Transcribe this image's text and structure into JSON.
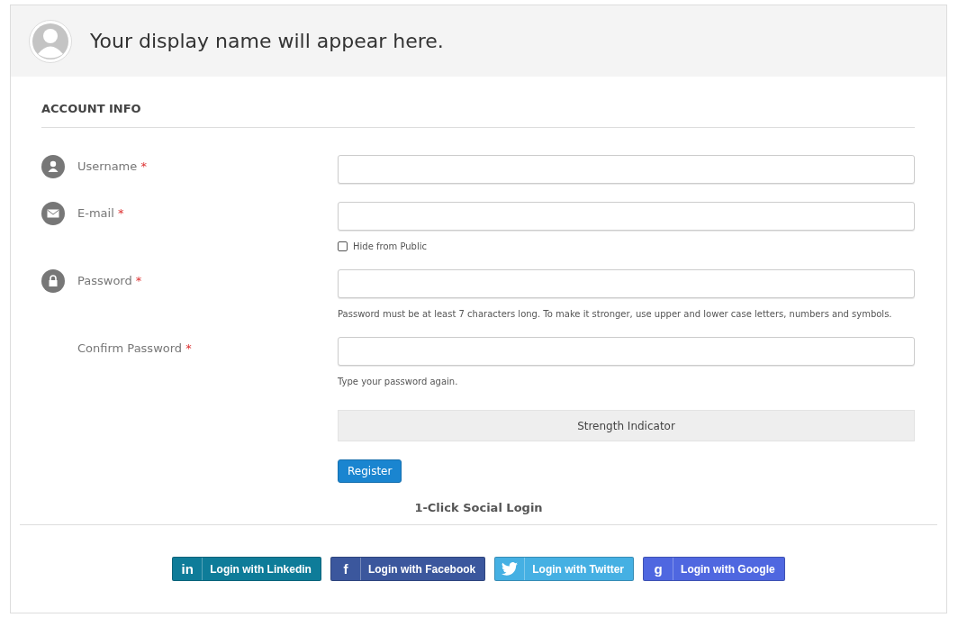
{
  "profile": {
    "display_name": "Your display name will appear here."
  },
  "section": {
    "title": "ACCOUNT INFO"
  },
  "fields": [
    {
      "kind": "user",
      "label": "Username",
      "required": "*"
    },
    {
      "kind": "mail",
      "label": "E-mail",
      "required": "*",
      "checkbox": {
        "label": "Hide from Public",
        "checked": false
      }
    },
    {
      "kind": "lock",
      "label": "Password",
      "required": "*",
      "hint": "Password must be at least 7 characters long. To make it stronger, use upper and lower case letters, numbers and symbols."
    },
    {
      "kind": "plain",
      "label": "Confirm Password",
      "required": "*",
      "hint": "Type your password again."
    }
  ],
  "strength": {
    "label": "Strength Indicator"
  },
  "register": {
    "label": "Register"
  },
  "social": {
    "title": "1-Click Social Login",
    "buttons": [
      {
        "kind": "linkedin",
        "glyph": "in",
        "label": "Login with Linkedin"
      },
      {
        "kind": "facebook",
        "glyph": "f",
        "label": "Login with Facebook"
      },
      {
        "kind": "twitter",
        "label": "Login with Twitter"
      },
      {
        "kind": "google",
        "glyph": "g",
        "label": "Login with Google"
      }
    ]
  }
}
